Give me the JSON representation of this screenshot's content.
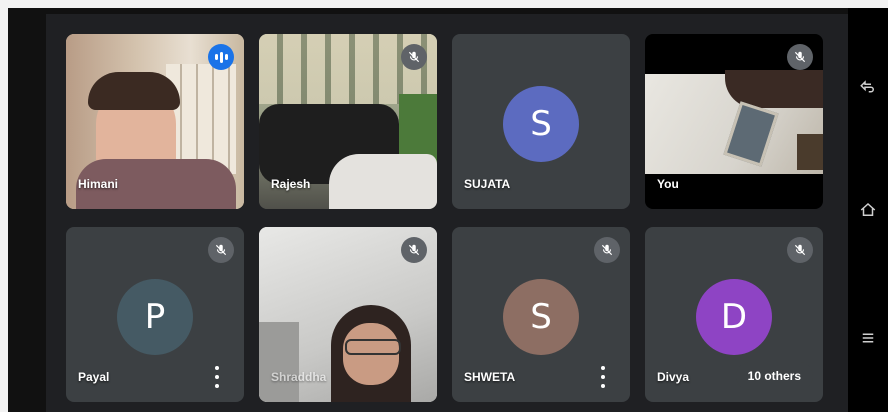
{
  "tiles": [
    {
      "name": "Himani",
      "state": "speaking"
    },
    {
      "name": "Rajesh",
      "state": "muted"
    },
    {
      "name": "SUJATA",
      "initial": "S",
      "avatar_color": "#5c6bc0",
      "state": "muted"
    },
    {
      "name": "You",
      "state": "muted"
    },
    {
      "name": "Payal",
      "initial": "P",
      "avatar_color": "#455a64",
      "state": "muted"
    },
    {
      "name": "Shraddha",
      "state": "muted"
    },
    {
      "name": "SHWETA",
      "initial": "S",
      "avatar_color": "#8d6e63",
      "state": "muted"
    },
    {
      "name": "Divya",
      "initial": "D",
      "avatar_color": "#8e44c4",
      "state": "muted"
    }
  ],
  "others_badge": "10 others",
  "nav": {
    "back": "back-icon",
    "home": "home-icon",
    "recents": "recents-icon"
  }
}
